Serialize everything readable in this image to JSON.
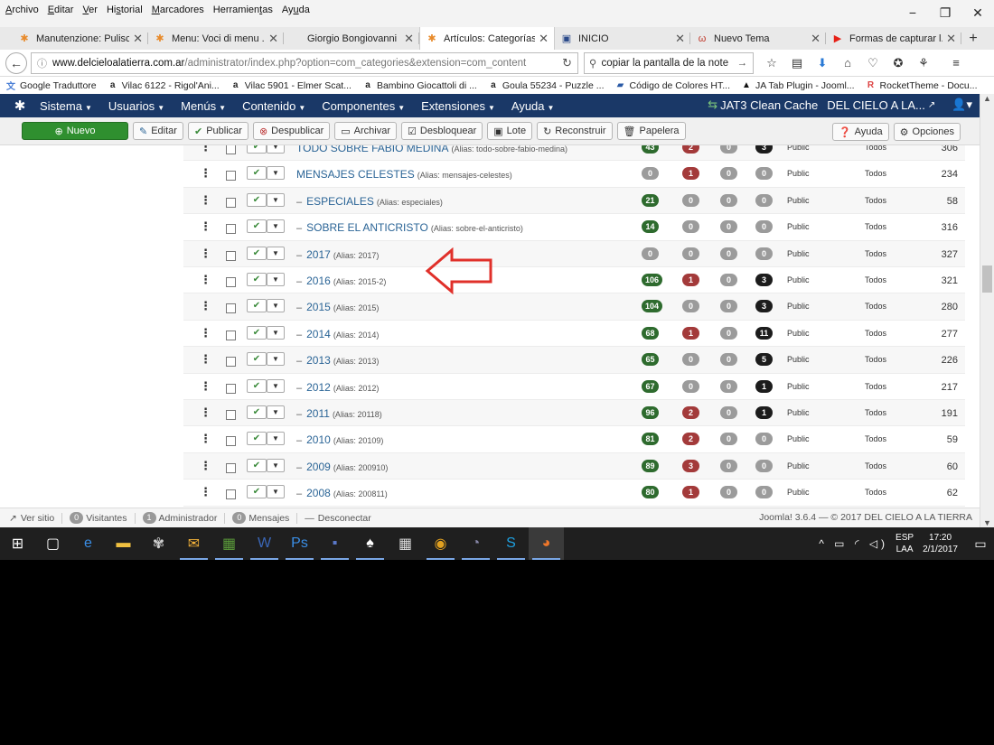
{
  "firefox_menu": [
    {
      "pre": "",
      "u": "A",
      "post": "rchivo"
    },
    {
      "pre": "",
      "u": "E",
      "post": "ditar"
    },
    {
      "pre": "",
      "u": "V",
      "post": "er"
    },
    {
      "pre": "Hi",
      "u": "s",
      "post": "torial"
    },
    {
      "pre": "",
      "u": "M",
      "post": "arcadores"
    },
    {
      "pre": "Herramien",
      "u": "t",
      "post": "as"
    },
    {
      "pre": "Ay",
      "u": "u",
      "post": "da"
    }
  ],
  "window_controls": {
    "minimize": "−",
    "restore": "❐",
    "close": "✕"
  },
  "tabs": [
    {
      "label": "Manutenzione: Pulisc...",
      "icon": "joomla-icon",
      "icon_color": "#e88a2a",
      "active": false
    },
    {
      "label": "Menu: Voci di menu ...",
      "icon": "joomla-icon",
      "icon_color": "#e88a2a",
      "active": false
    },
    {
      "label": "Giorgio Bongiovanni",
      "icon": "",
      "icon_color": "",
      "active": false
    },
    {
      "label": "Artículos: Categorías ...",
      "icon": "joomla-icon",
      "icon_color": "#e88a2a",
      "active": true
    },
    {
      "label": "INICIO",
      "icon": "site-icon",
      "icon_color": "#2b4a8a",
      "active": false
    },
    {
      "label": "Nuevo Tema",
      "icon": "forum-icon",
      "icon_color": "#c0392b",
      "active": false
    },
    {
      "label": "Formas de capturar l...",
      "icon": "youtube-icon",
      "icon_color": "#e62117",
      "active": false
    }
  ],
  "url": {
    "domain": "www.delcieloalatierra.com.ar",
    "rest": "/administrator/index.php?option=com_categories&extension=com_content"
  },
  "search": {
    "value": "copiar la pantalla de la note"
  },
  "bookmarks": [
    {
      "label": "Google Traduttore",
      "icon": "translate-icon",
      "color": "#4a7fd6"
    },
    {
      "label": "Vilac 6122 - Rigol'Ani...",
      "icon": "amazon-icon",
      "color": "#222"
    },
    {
      "label": "Vilac 5901 - Elmer Scat...",
      "icon": "amazon-icon",
      "color": "#222"
    },
    {
      "label": "Bambino Giocattoli di ...",
      "icon": "amazon-icon",
      "color": "#222"
    },
    {
      "label": "Goula 55234 - Puzzle ...",
      "icon": "amazon-icon",
      "color": "#222"
    },
    {
      "label": "Código de Colores HT...",
      "icon": "bookmark-icon",
      "color": "#2a5aa6"
    },
    {
      "label": "JA Tab Plugin - Jooml...",
      "icon": "ja-icon",
      "color": "#111"
    },
    {
      "label": "RocketTheme - Docu...",
      "icon": "rocket-icon",
      "color": "#d44"
    }
  ],
  "joomla_menu": [
    "Sistema",
    "Usuarios",
    "Menús",
    "Contenido",
    "Componentes",
    "Extensiones",
    "Ayuda"
  ],
  "joomla_right": {
    "cache": "JAT3 Clean Cache",
    "site": "DEL CIELO A LA..."
  },
  "toolbar": {
    "nuevo": "Nuevo",
    "editar": "Editar",
    "publicar": "Publicar",
    "despublicar": "Despublicar",
    "archivar": "Archivar",
    "desbloquear": "Desbloquear",
    "lote": "Lote",
    "reconstruir": "Reconstruir",
    "papelera": "Papelera",
    "ayuda": "Ayuda",
    "opciones": "Opciones"
  },
  "rows": [
    {
      "title": "TODO SOBRE FABIO MEDINA",
      "alias": "(Alias: todo-sobre-fabio-medina)",
      "prefix": "",
      "b": [
        "43",
        "2",
        "0",
        "3"
      ],
      "access": "Public",
      "lang": "Todos",
      "id": "306"
    },
    {
      "title": "MENSAJES CELESTES",
      "alias": "(Alias: mensajes-celestes)",
      "prefix": "",
      "b": [
        "0",
        "1",
        "0",
        "0"
      ],
      "access": "Public",
      "lang": "Todos",
      "id": "234"
    },
    {
      "title": "ESPECIALES",
      "alias": "(Alias: especiales)",
      "prefix": "–",
      "b": [
        "21",
        "0",
        "0",
        "0"
      ],
      "access": "Public",
      "lang": "Todos",
      "id": "58"
    },
    {
      "title": "SOBRE EL ANTICRISTO",
      "alias": "(Alias: sobre-el-anticristo)",
      "prefix": "–",
      "b": [
        "14",
        "0",
        "0",
        "0"
      ],
      "access": "Public",
      "lang": "Todos",
      "id": "316"
    },
    {
      "title": "2017",
      "alias": "(Alias: 2017)",
      "prefix": "–",
      "b": [
        "0",
        "0",
        "0",
        "0"
      ],
      "access": "Public",
      "lang": "Todos",
      "id": "327"
    },
    {
      "title": "2016",
      "alias": "(Alias: 2015-2)",
      "prefix": "–",
      "b": [
        "106",
        "1",
        "0",
        "3"
      ],
      "access": "Public",
      "lang": "Todos",
      "id": "321"
    },
    {
      "title": "2015",
      "alias": "(Alias: 2015)",
      "prefix": "–",
      "b": [
        "104",
        "0",
        "0",
        "3"
      ],
      "access": "Public",
      "lang": "Todos",
      "id": "280"
    },
    {
      "title": "2014",
      "alias": "(Alias: 2014)",
      "prefix": "–",
      "b": [
        "68",
        "1",
        "0",
        "11"
      ],
      "access": "Public",
      "lang": "Todos",
      "id": "277"
    },
    {
      "title": "2013",
      "alias": "(Alias: 2013)",
      "prefix": "–",
      "b": [
        "65",
        "0",
        "0",
        "5"
      ],
      "access": "Public",
      "lang": "Todos",
      "id": "226"
    },
    {
      "title": "2012",
      "alias": "(Alias: 2012)",
      "prefix": "–",
      "b": [
        "67",
        "0",
        "0",
        "1"
      ],
      "access": "Public",
      "lang": "Todos",
      "id": "217"
    },
    {
      "title": "2011",
      "alias": "(Alias: 20118)",
      "prefix": "–",
      "b": [
        "96",
        "2",
        "0",
        "1"
      ],
      "access": "Public",
      "lang": "Todos",
      "id": "191"
    },
    {
      "title": "2010",
      "alias": "(Alias: 20109)",
      "prefix": "–",
      "b": [
        "81",
        "2",
        "0",
        "0"
      ],
      "access": "Public",
      "lang": "Todos",
      "id": "59"
    },
    {
      "title": "2009",
      "alias": "(Alias: 200910)",
      "prefix": "–",
      "b": [
        "89",
        "3",
        "0",
        "0"
      ],
      "access": "Public",
      "lang": "Todos",
      "id": "60"
    },
    {
      "title": "2008",
      "alias": "(Alias: 200811)",
      "prefix": "–",
      "b": [
        "80",
        "1",
        "0",
        "0"
      ],
      "access": "Public",
      "lang": "Todos",
      "id": "62"
    }
  ],
  "status_colors": {
    "published": "#2e6b2e",
    "unpublished": "#a33a3a",
    "archived": "#9b9b9b",
    "trashed": "#1c1c1c"
  },
  "statusbar": {
    "ver_sitio": "Ver sitio",
    "visitantes_count": "0",
    "visitantes": "Visitantes",
    "admin_count": "1",
    "admin": "Administrador",
    "mensajes_count": "0",
    "mensajes": "Mensajes",
    "desconectar": "Desconectar",
    "footer": "Joomla! 3.6.4 — © 2017 DEL CIELO A LA TIERRA"
  },
  "taskbar": {
    "icons": [
      "windows-start-icon",
      "task-view-icon",
      "edge-icon",
      "explorer-icon",
      "tool-icon",
      "outlook-icon",
      "excel-icon",
      "word-icon",
      "photoshop-icon",
      "save-icon",
      "cards-icon",
      "calculator-icon",
      "chrome-icon",
      "player-icon",
      "skype-icon",
      "firefox-icon"
    ],
    "lang_top": "ESP",
    "lang_bottom": "LAA",
    "time": "17:20",
    "date": "2/1/2017"
  }
}
